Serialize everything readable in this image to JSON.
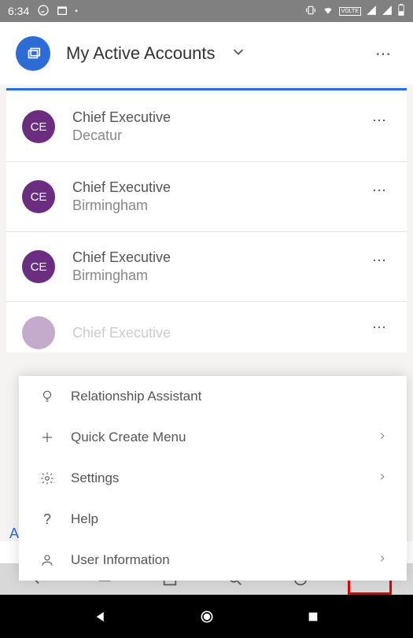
{
  "status_bar": {
    "time": "6:34"
  },
  "header": {
    "title": "My Active Accounts"
  },
  "list": {
    "items": [
      {
        "avatar": "CE",
        "title": "Chief Executive",
        "subtitle": "Decatur"
      },
      {
        "avatar": "CE",
        "title": "Chief Executive",
        "subtitle": "Birmingham"
      },
      {
        "avatar": "CE",
        "title": "Chief Executive",
        "subtitle": "Birmingham"
      }
    ],
    "partial": {
      "title": "Chief Executive"
    }
  },
  "menu": {
    "items": [
      {
        "label": "Relationship Assistant",
        "chevron": false
      },
      {
        "label": "Quick Create Menu",
        "chevron": true
      },
      {
        "label": "Settings",
        "chevron": true
      },
      {
        "label": "Help",
        "chevron": false
      },
      {
        "label": "User Information",
        "chevron": true
      }
    ]
  },
  "a_letter": "A"
}
